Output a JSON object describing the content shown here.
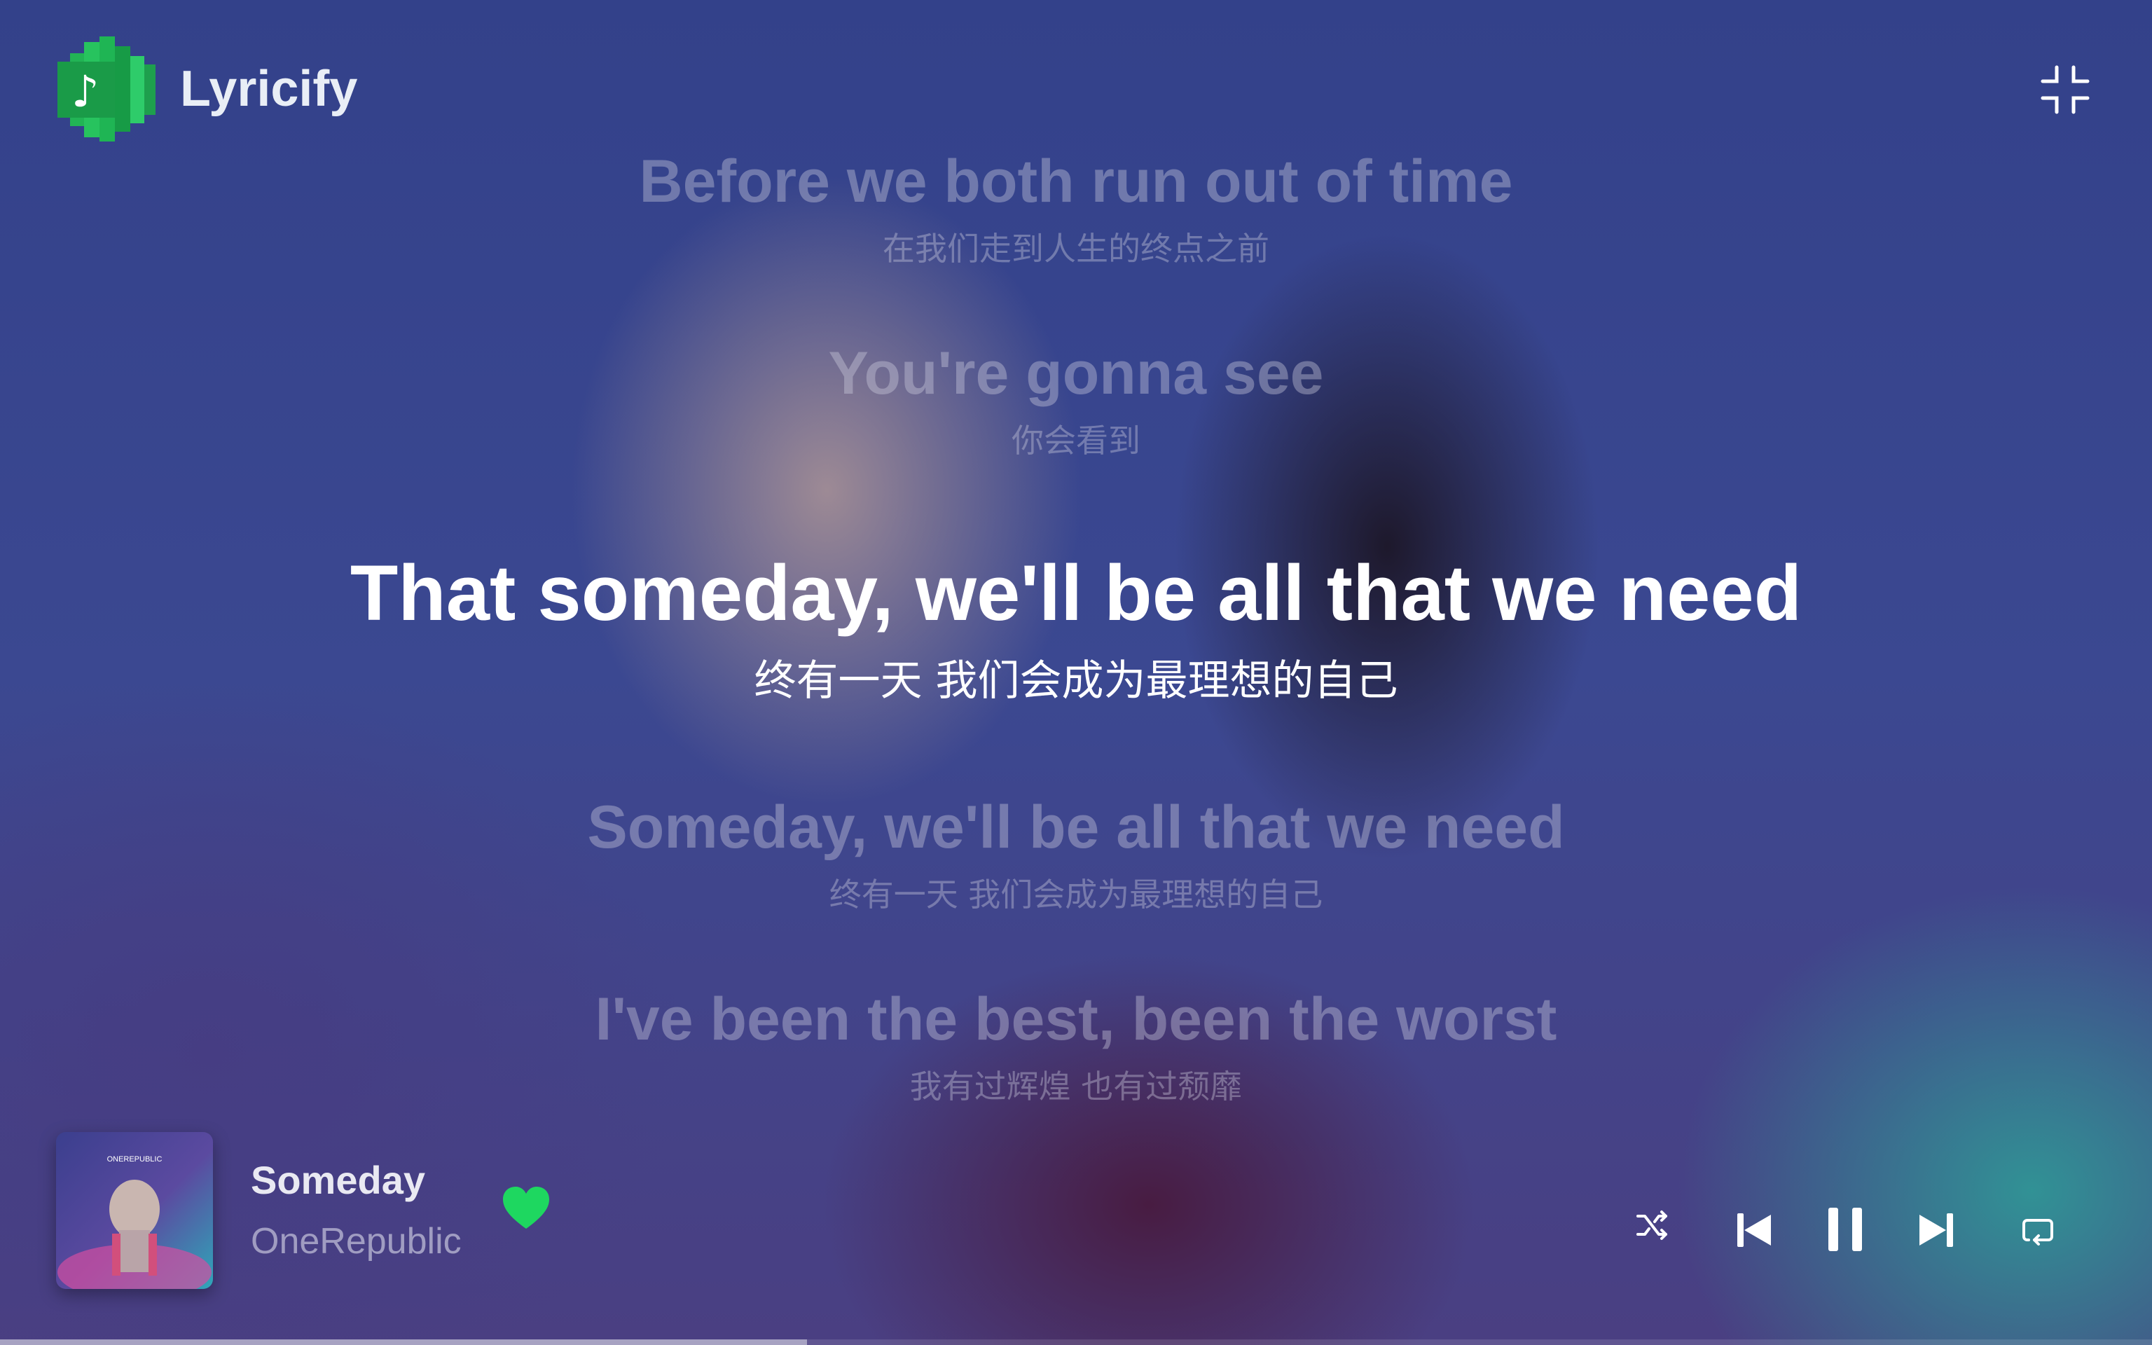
{
  "app": {
    "name": "Lyricify"
  },
  "lyrics": [
    {
      "en": "Before we both run out of time",
      "zh": "在我们走到人生的终点之前",
      "active": false
    },
    {
      "en": "You're gonna see",
      "zh": "你会看到",
      "active": false
    },
    {
      "en": "That someday, we'll be all that we need",
      "zh": "终有一天 我们会成为最理想的自己",
      "active": true
    },
    {
      "en": "Someday, we'll be all that we need",
      "zh": "终有一天 我们会成为最理想的自己",
      "active": false
    },
    {
      "en": "I've been the best, been the worst",
      "zh": "我有过辉煌 也有过颓靡",
      "active": false
    }
  ],
  "now_playing": {
    "title": "Someday",
    "artist": "OneRepublic",
    "liked": true,
    "cover_text": "ONEREPUBLIC"
  },
  "controls": {
    "shuffle_icon": "shuffle-icon",
    "previous_icon": "skip-previous-icon",
    "play_pause_icon": "pause-icon",
    "next_icon": "skip-next-icon",
    "repeat_icon": "repeat-icon"
  },
  "playback": {
    "progress": 0.375
  },
  "colors": {
    "accent": "#1ed760",
    "text": "#ffffff"
  }
}
